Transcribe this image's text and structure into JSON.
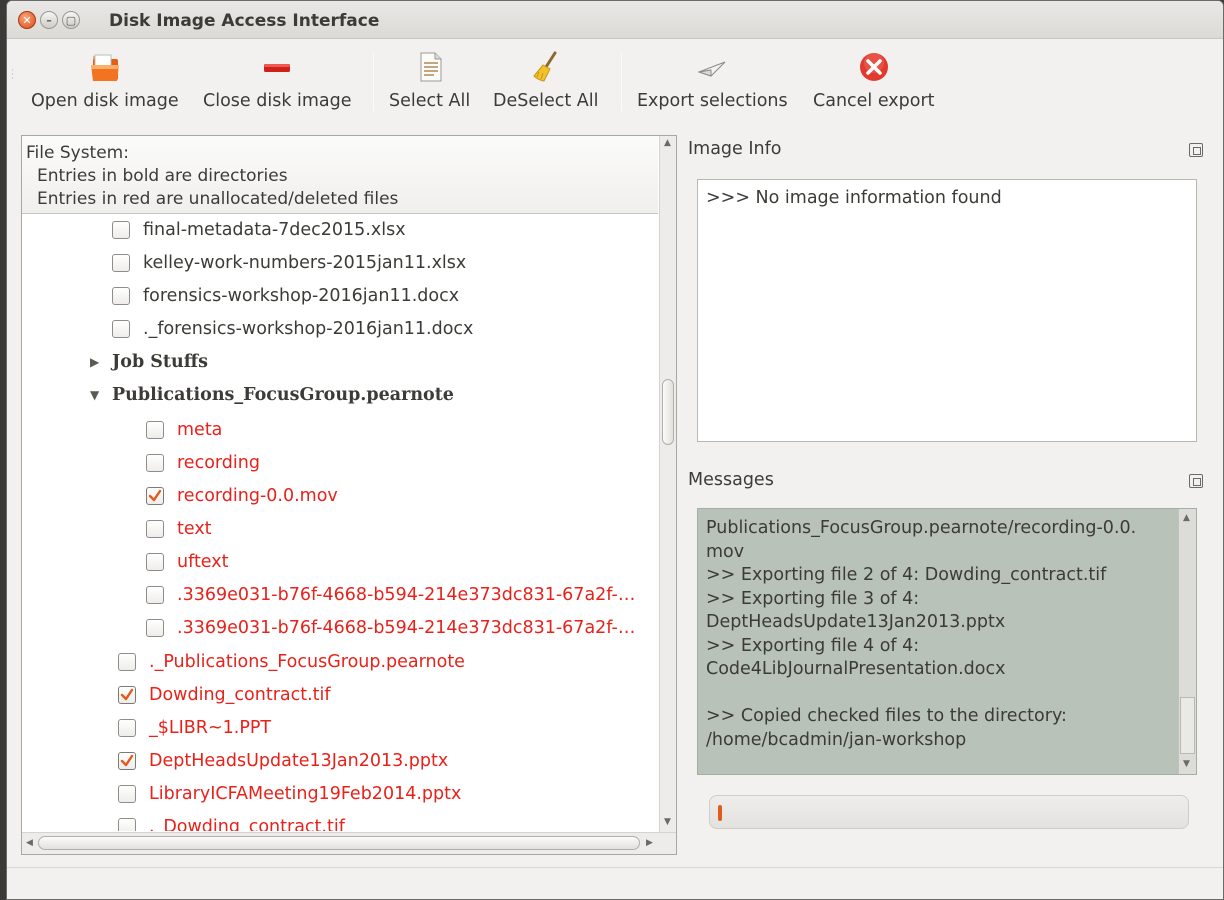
{
  "window": {
    "title": "Disk Image Access Interface"
  },
  "toolbar": {
    "open_label": "Open disk image",
    "close_label": "Close disk image",
    "select_all_label": "Select All",
    "deselect_all_label": "DeSelect All",
    "export_label": "Export selections",
    "cancel_label": "Cancel export"
  },
  "filesystem": {
    "header_title": "File System:",
    "header_line1": "Entries in bold are directories",
    "header_line2": "Entries in red are unallocated/deleted files",
    "rows": [
      {
        "name": "final-metadata-7dec2015.xlsx",
        "checked": false,
        "red": false
      },
      {
        "name": "kelley-work-numbers-2015jan11.xlsx",
        "checked": false,
        "red": false
      },
      {
        "name": "forensics-workshop-2016jan11.docx",
        "checked": false,
        "red": false
      },
      {
        "name": "._forensics-workshop-2016jan11.docx",
        "checked": false,
        "red": false
      },
      {
        "name": "Job Stuffs",
        "dir": true,
        "expanded": false
      },
      {
        "name": "Publications_FocusGroup.pearnote",
        "dir": true,
        "expanded": true
      },
      {
        "name": "meta",
        "checked": false,
        "red": true
      },
      {
        "name": "recording",
        "checked": false,
        "red": true
      },
      {
        "name": "recording-0.0.mov",
        "checked": true,
        "red": true
      },
      {
        "name": "text",
        "checked": false,
        "red": true
      },
      {
        "name": "uftext",
        "checked": false,
        "red": true
      },
      {
        "name": ".3369e031-b76f-4668-b594-214e373dc831-67a2f-…",
        "checked": false,
        "red": true
      },
      {
        "name": ".3369e031-b76f-4668-b594-214e373dc831-67a2f-…",
        "checked": false,
        "red": true
      },
      {
        "name": "._Publications_FocusGroup.pearnote",
        "checked": false,
        "red": true
      },
      {
        "name": "Dowding_contract.tif",
        "checked": true,
        "red": true
      },
      {
        "name": "_$LIBR~1.PPT",
        "checked": false,
        "red": true
      },
      {
        "name": "DeptHeadsUpdate13Jan2013.pptx",
        "checked": true,
        "red": true
      },
      {
        "name": "LibraryICFAMeeting19Feb2014.pptx",
        "checked": false,
        "red": true
      },
      {
        "name": "._Dowding_contract.tif",
        "checked": false,
        "red": true
      }
    ]
  },
  "image_info": {
    "label": "Image Info",
    "text": ">>> No image information found"
  },
  "messages": {
    "label": "Messages",
    "lines": [
      "Publications_FocusGroup.pearnote/recording-0.0.",
      "mov",
      ">> Exporting file 2 of 4: Dowding_contract.tif",
      ">> Exporting file 3 of 4:",
      "DeptHeadsUpdate13Jan2013.pptx",
      ">> Exporting file 4 of 4:",
      "Code4LibJournalPresentation.docx",
      "",
      ">> Copied checked files to the directory:",
      "/home/bcadmin/jan-workshop"
    ]
  },
  "progress": {
    "fraction": 0.01
  },
  "colors": {
    "deleted": "#e8221a",
    "accent": "#e35a1c",
    "messages_bg": "#b9c2b8"
  }
}
